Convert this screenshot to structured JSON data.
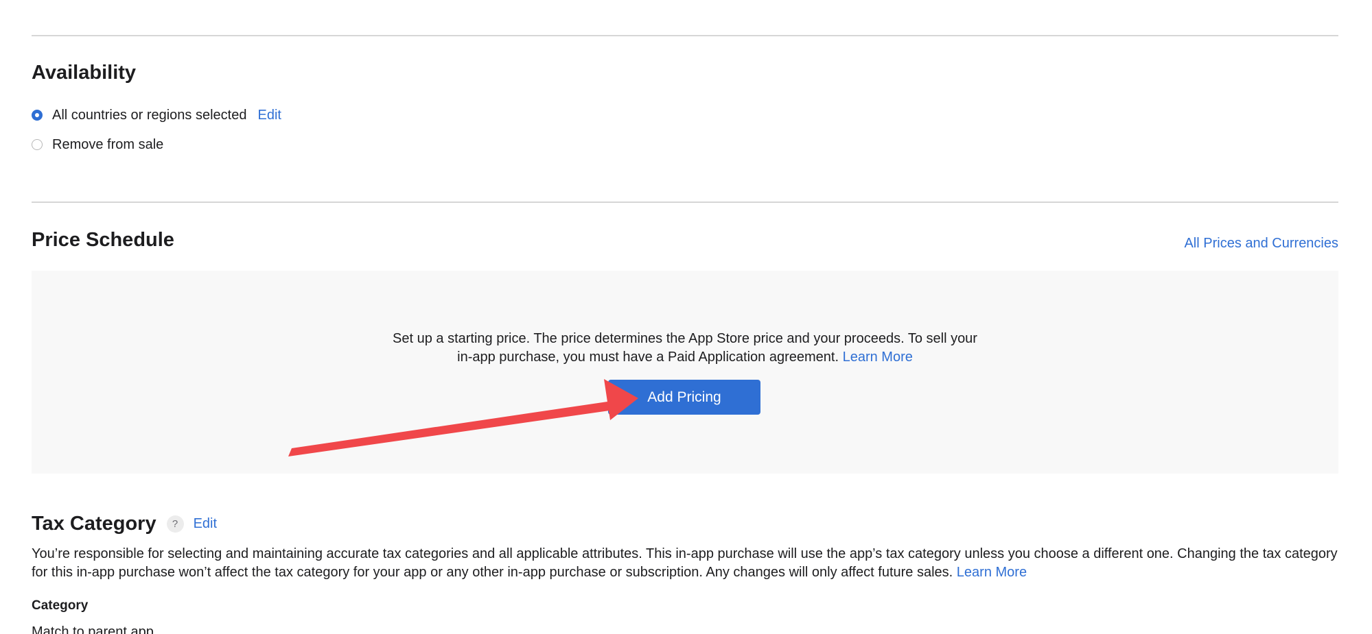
{
  "availability": {
    "title": "Availability",
    "options": [
      {
        "label": "All countries or regions selected",
        "selected": true,
        "action": "Edit"
      },
      {
        "label": "Remove from sale",
        "selected": false
      }
    ]
  },
  "price_schedule": {
    "title": "Price Schedule",
    "all_prices_link": "All Prices and Currencies",
    "description_line1": "Set up a starting price. The price determines the App Store price and your proceeds. To sell your",
    "description_line2": "in-app purchase, you must have a Paid Application agreement.",
    "learn_more": "Learn More",
    "add_button": "Add Pricing"
  },
  "tax_category": {
    "title": "Tax Category",
    "help": "?",
    "edit": "Edit",
    "description": "You’re responsible for selecting and maintaining accurate tax categories and all applicable attributes. This in-app purchase will use the app’s tax category unless you choose a different one. Changing the tax category for this in-app purchase won’t affect the tax category for your app or any other in-app purchase or subscription. Any changes will only affect future sales.",
    "learn_more": "Learn More",
    "category_label": "Category",
    "category_value": "Match to parent app"
  },
  "colors": {
    "accent": "#2f6fd4",
    "annotation_arrow": "#f0474a",
    "panel_bg": "#f8f8f8",
    "divider": "#d6d6d6"
  }
}
